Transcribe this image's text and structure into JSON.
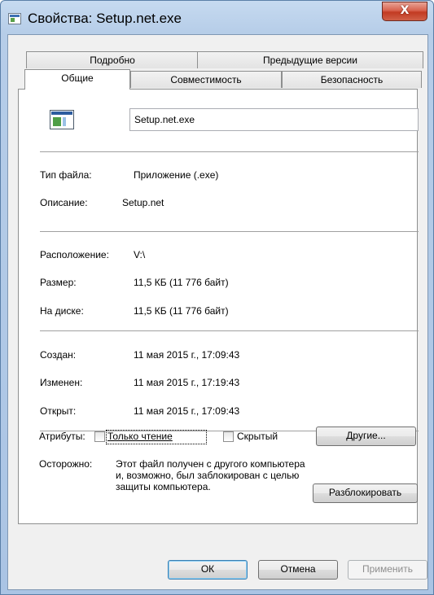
{
  "window": {
    "title": "Свойства: Setup.net.exe",
    "close_label": "X"
  },
  "tabs": {
    "row_back": [
      "Подробно",
      "Предыдущие версии"
    ],
    "row_front": [
      "Общие",
      "Совместимость",
      "Безопасность"
    ],
    "active": "Общие"
  },
  "general": {
    "file_name": "Setup.net.exe",
    "file_type_label": "Тип файла:",
    "file_type_value": "Приложение (.exe)",
    "description_label": "Описание:",
    "description_value": "Setup.net",
    "location_label": "Расположение:",
    "location_value": "V:\\",
    "size_label": "Размер:",
    "size_value": "11,5 КБ (11 776 байт)",
    "on_disk_label": "На диске:",
    "on_disk_value": "11,5 КБ (11 776 байт)",
    "created_label": "Создан:",
    "created_value": "11 мая 2015 г., 17:09:43",
    "modified_label": "Изменен:",
    "modified_value": "11 мая 2015 г., 17:19:43",
    "accessed_label": "Открыт:",
    "accessed_value": "11 мая 2015 г., 17:09:43",
    "attributes_label": "Атрибуты:",
    "readonly_label": "Только чтение",
    "readonly_checked": false,
    "hidden_label": "Скрытый",
    "hidden_checked": false,
    "other_button": "Другие...",
    "caution_label": "Осторожно:",
    "caution_text": "Этот файл получен с другого компьютера и, возможно, был заблокирован с целью защиты компьютера.",
    "unblock_button": "Разблокировать"
  },
  "footer": {
    "ok": "ОК",
    "cancel": "Отмена",
    "apply": "Применить"
  },
  "colors": {
    "accent_border": "#3c7fb1",
    "close_red": "#c23a22",
    "frame_blue": "#aac4e4"
  }
}
